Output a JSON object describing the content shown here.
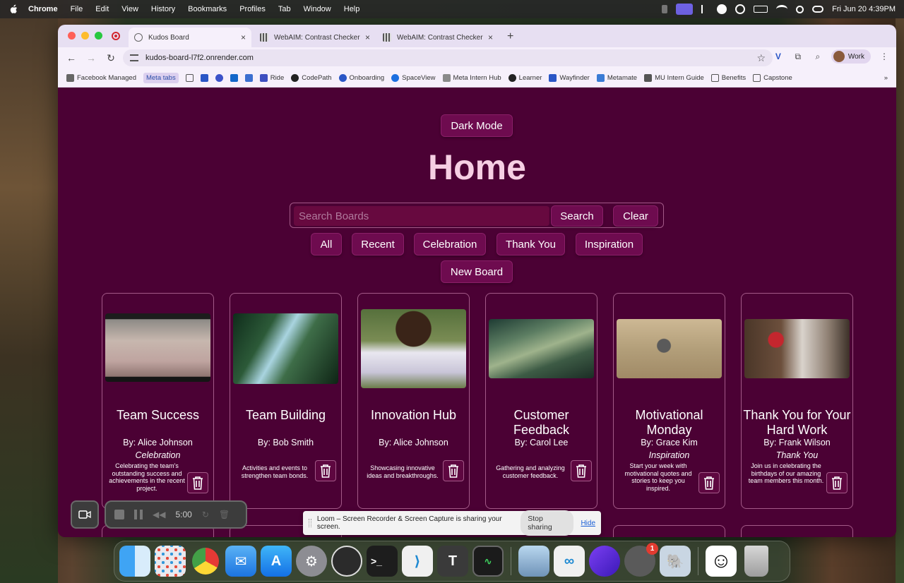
{
  "menubar": {
    "app_name": "Chrome",
    "items": [
      "File",
      "Edit",
      "View",
      "History",
      "Bookmarks",
      "Profiles",
      "Tab",
      "Window",
      "Help"
    ],
    "datetime": "Fri Jun 20  4:39PM"
  },
  "browser": {
    "tabs": [
      {
        "label": "Kudos Board",
        "active": true
      },
      {
        "label": "WebAIM: Contrast Checker",
        "active": false
      },
      {
        "label": "WebAIM: Contrast Checker",
        "active": false
      }
    ],
    "url": "kudos-board-l7f2.onrender.com",
    "profile_label": "Work",
    "bookmarks": [
      "Facebook Managed",
      "Meta tabs",
      "Ride",
      "CodePath",
      "Onboarding",
      "SpaceView",
      "Meta Intern Hub",
      "Learner",
      "Wayfinder",
      "Metamate",
      "MU Intern Guide",
      "Benefits",
      "Capstone"
    ]
  },
  "page": {
    "dark_mode_label": "Dark Mode",
    "title": "Home",
    "search_placeholder": "Search Boards",
    "search_label": "Search",
    "clear_label": "Clear",
    "filters": [
      "All",
      "Recent",
      "Celebration",
      "Thank You",
      "Inspiration"
    ],
    "new_board_label": "New Board",
    "boards": [
      {
        "title": "Team Success",
        "author": "By: Alice Johnson",
        "category": "Celebration",
        "description": "Celebrating the team's outstanding success and achievements in the recent project."
      },
      {
        "title": "Team Building",
        "author": "By: Bob Smith",
        "category": "",
        "description": "Activities and events to strengthen team bonds."
      },
      {
        "title": "Innovation Hub",
        "author": "By: Alice Johnson",
        "category": "",
        "description": "Showcasing innovative ideas and breakthroughs."
      },
      {
        "title": "Customer Feedback",
        "author": "By: Carol Lee",
        "category": "",
        "description": "Gathering and analyzing customer feedback."
      },
      {
        "title": "Motivational Monday",
        "author": "By: Grace Kim",
        "category": "Inspiration",
        "description": "Start your week with motivational quotes and stories to keep you inspired."
      },
      {
        "title": "Thank You for Your Hard Work",
        "author": "By: Frank Wilson",
        "category": "Thank You",
        "description": "Join us in celebrating the birthdays of our amazing team members this month."
      }
    ]
  },
  "recorder": {
    "timer": "5:00",
    "share_message": "Loom – Screen Recorder & Screen Capture is sharing your screen.",
    "stop_label": "Stop sharing",
    "hide_label": "Hide"
  },
  "dock": {
    "badge_count": "1"
  },
  "colors": {
    "page_bg": "#4b0134",
    "button_bg": "#6e0b4f",
    "title_color": "#f6cfe3"
  }
}
